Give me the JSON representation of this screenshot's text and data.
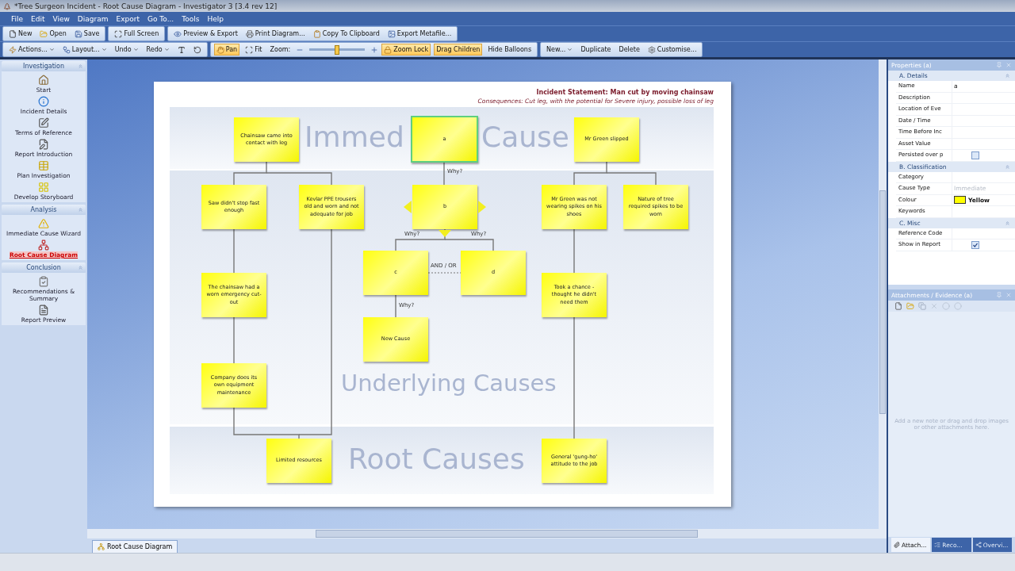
{
  "window": {
    "title": "*Tree Surgeon Incident - Root Cause Diagram - Investigator 3 [3.4 rev 12]"
  },
  "menu": [
    "File",
    "Edit",
    "View",
    "Diagram",
    "Export",
    "Go To...",
    "Tools",
    "Help"
  ],
  "toolbar_main": [
    [
      {
        "label": "New"
      },
      {
        "label": "Open"
      },
      {
        "label": "Save"
      }
    ],
    [
      {
        "label": "Full Screen"
      }
    ],
    [
      {
        "label": "Preview & Export"
      },
      {
        "label": "Print Diagram..."
      },
      {
        "label": "Copy To Clipboard"
      },
      {
        "label": "Export Metafile..."
      }
    ]
  ],
  "toolbar_diagram": [
    [
      {
        "kind": "dropdown",
        "label": "Actions..."
      },
      {
        "kind": "dropdown",
        "label": "Layout..."
      },
      {
        "kind": "dropdown",
        "label": "Undo"
      },
      {
        "kind": "dropdown",
        "label": "Redo"
      },
      {
        "kind": "icon"
      },
      {
        "kind": "icon"
      }
    ],
    [
      {
        "kind": "toggle",
        "label": "Pan",
        "on": true
      },
      {
        "kind": "button",
        "label": "Fit"
      },
      {
        "kind": "slider",
        "label": "Zoom:",
        "level": 0.5
      },
      {
        "kind": "toggle",
        "label": "Zoom Lock",
        "on": true
      },
      {
        "kind": "toggle",
        "label": "Drag Children",
        "on": true
      },
      {
        "kind": "button",
        "label": "Hide Balloons"
      }
    ],
    [
      {
        "kind": "dropdown",
        "label": "New..."
      },
      {
        "kind": "button",
        "label": "Duplicate"
      },
      {
        "kind": "button",
        "label": "Delete"
      },
      {
        "kind": "button",
        "label": "Customise..."
      }
    ]
  ],
  "sidebar": [
    {
      "title": "Investigation",
      "items": [
        {
          "label": "Start",
          "selected": false
        },
        {
          "label": "Incident Details",
          "selected": false
        },
        {
          "label": "Terms of Reference",
          "selected": false
        },
        {
          "label": "Report Introduction",
          "selected": false
        },
        {
          "label": "Plan Investigation",
          "selected": false
        },
        {
          "label": "Develop Storyboard",
          "selected": false
        }
      ]
    },
    {
      "title": "Analysis",
      "items": [
        {
          "label": "Immediate Cause Wizard",
          "selected": false
        },
        {
          "label": "Root Cause Diagram",
          "selected": true
        }
      ]
    },
    {
      "title": "Conclusion",
      "items": [
        {
          "label": "Recommendations & Summary",
          "selected": false
        },
        {
          "label": "Report Preview",
          "selected": false
        }
      ]
    }
  ],
  "diagram": {
    "statement": "Incident Statement: Man cut by moving chainsaw",
    "consequences": "Consequences: Cut leg, with the potential for Severe injury, possible loss of leg",
    "bands": [
      {
        "labels": [
          "Immed",
          "Cause"
        ]
      },
      {
        "labels": [
          "Underlying Causes"
        ]
      },
      {
        "labels": [
          "Root Causes"
        ]
      }
    ],
    "nodes": [
      {
        "text": "Chainsaw came into contact with leg",
        "selected": false,
        "handles": false
      },
      {
        "text": "a",
        "selected": true,
        "handles": false
      },
      {
        "text": "Mr Green slipped",
        "selected": false,
        "handles": false
      },
      {
        "text": "Saw didn't stop fast enough",
        "selected": false,
        "handles": false
      },
      {
        "text": "Kevlar PPE trousers old and worn and not adequate for job",
        "selected": false,
        "handles": false
      },
      {
        "text": "b",
        "selected": false,
        "handles": true
      },
      {
        "text": "Mr Green was not wearing spikes on his shoes",
        "selected": false,
        "handles": false
      },
      {
        "text": "Nature of tree required spikes to be worn",
        "selected": false,
        "handles": false
      },
      {
        "text": "c",
        "selected": false,
        "handles": false
      },
      {
        "text": "d",
        "selected": false,
        "handles": false
      },
      {
        "text": "The chainsaw had a worn emergency cut-out",
        "selected": false,
        "handles": false
      },
      {
        "text": "Took a chance - thought he didn't need them",
        "selected": false,
        "handles": false
      },
      {
        "text": "New Cause",
        "selected": false,
        "handles": false
      },
      {
        "text": "Company does its own equipment maintenance",
        "selected": false,
        "handles": false
      },
      {
        "text": "Limited resources",
        "selected": false,
        "handles": false
      },
      {
        "text": "General 'gung-ho' attitude to the job",
        "selected": false,
        "handles": false
      }
    ],
    "link_labels": [
      "Why?",
      "Why?",
      "Why?",
      "AND / OR",
      "Why?"
    ]
  },
  "document_tab": "Root Cause Diagram",
  "properties": {
    "title": "Properties (a)",
    "sections": [
      {
        "title": "A. Details",
        "rows": [
          {
            "kind": "text",
            "name": "Name",
            "value": "a"
          },
          {
            "kind": "text",
            "name": "Description"
          },
          {
            "kind": "text",
            "name": "Location of Eve"
          },
          {
            "kind": "text",
            "name": "Date / Time"
          },
          {
            "kind": "text",
            "name": "Time Before Inc"
          },
          {
            "kind": "text",
            "name": "Asset Value"
          },
          {
            "kind": "checkbox",
            "name": "Persisted over p",
            "checked": false
          }
        ]
      },
      {
        "title": "B. Classification",
        "rows": [
          {
            "kind": "text",
            "name": "Category"
          },
          {
            "kind": "text",
            "name": "Cause Type",
            "value": "Immediate",
            "disabled": true
          },
          {
            "kind": "colour",
            "name": "Colour",
            "value": "Yellow",
            "color": "#ffff00"
          },
          {
            "kind": "text",
            "name": "Keywords"
          }
        ]
      },
      {
        "title": "C. Misc",
        "rows": [
          {
            "kind": "text",
            "name": "Reference Code"
          },
          {
            "kind": "checkbox",
            "name": "Show in Report",
            "checked": true
          }
        ]
      }
    ]
  },
  "attachments": {
    "title": "Attachments / Evidence (a)",
    "hint": "Add a new note or drag and drop images or other attachments here."
  },
  "panel_tabs": [
    {
      "label": "Attach...",
      "selected": true
    },
    {
      "label": "Reco...",
      "selected": false
    },
    {
      "label": "Overvi...",
      "selected": false
    }
  ]
}
